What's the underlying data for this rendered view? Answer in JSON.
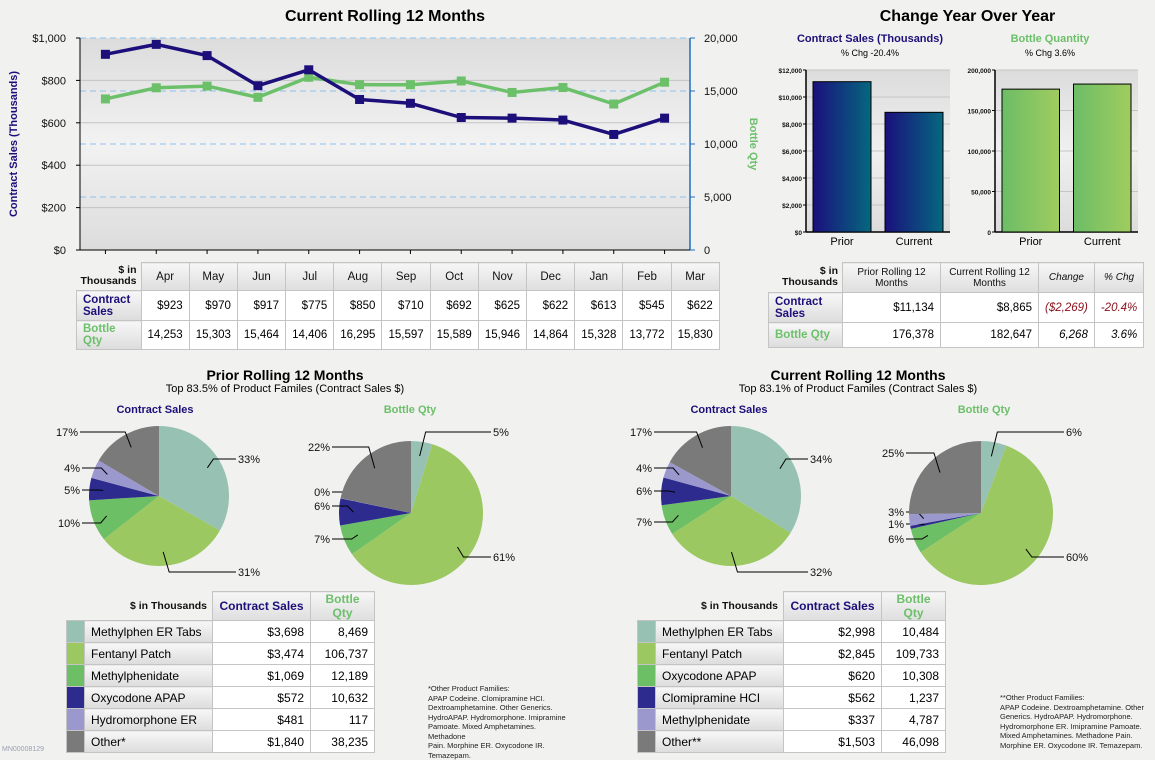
{
  "colors": {
    "navy": "#1c0f7a",
    "green": "#6cc06a",
    "teal": "#97c2b3",
    "lime": "#9cc862",
    "midgreen": "#6cbf64",
    "indigo": "#2e2b8f",
    "lavender": "#9a98cc",
    "gray": "#7a7a7a",
    "negative": "#8a0f1a"
  },
  "chart_data": [
    {
      "type": "line",
      "title": "Current Rolling 12 Months",
      "ylabel": "Contract Sales (Thousands)",
      "y2label": "Bottle Qty",
      "categories": [
        "Apr",
        "May",
        "Jun",
        "Jul",
        "Aug",
        "Sep",
        "Oct",
        "Nov",
        "Dec",
        "Jan",
        "Feb",
        "Mar"
      ],
      "series": [
        {
          "name": "Contract Sales",
          "axis": "left",
          "values": [
            923,
            970,
            917,
            775,
            850,
            710,
            692,
            625,
            622,
            613,
            545,
            622
          ]
        },
        {
          "name": "Bottle Qty",
          "axis": "right",
          "values": [
            14253,
            15303,
            15464,
            14406,
            16295,
            15597,
            15589,
            15946,
            14864,
            15328,
            13772,
            15830
          ]
        }
      ],
      "ylim": [
        0,
        1000
      ],
      "yticks": [
        "$0",
        "$200",
        "$400",
        "$600",
        "$800",
        "$1,000"
      ],
      "y2lim": [
        0,
        20000
      ],
      "y2ticks": [
        "0",
        "5,000",
        "10,000",
        "15,000",
        "20,000"
      ],
      "grid": true
    },
    {
      "type": "bar",
      "title": "Contract Sales (Thousands)",
      "subtitle": "% Chg -20.4%",
      "categories": [
        "Prior",
        "Current"
      ],
      "values": [
        11134,
        8865
      ],
      "ylim": [
        0,
        12000
      ],
      "yticks": [
        "$0",
        "$2,000",
        "$4,000",
        "$6,000",
        "$8,000",
        "$10,000",
        "$12,000"
      ]
    },
    {
      "type": "bar",
      "title": "Bottle Quantity",
      "subtitle": "% Chg 3.6%",
      "categories": [
        "Prior",
        "Current"
      ],
      "values": [
        176378,
        182647
      ],
      "ylim": [
        0,
        200000
      ],
      "yticks": [
        "0",
        "50,000",
        "100,000",
        "150,000",
        "200,000"
      ]
    },
    {
      "type": "pie",
      "title": "Contract Sales",
      "group": "Prior Rolling 12 Months",
      "labels": [
        "Methylphen ER Tabs",
        "Fentanyl Patch",
        "Methylphenidate",
        "Oxycodone APAP",
        "Hydromorphone ER",
        "Other*"
      ],
      "values": [
        3698,
        3474,
        1069,
        572,
        481,
        1840
      ],
      "pct_labels": [
        "33%",
        "31%",
        "10%",
        "5%",
        "4%",
        "17%"
      ]
    },
    {
      "type": "pie",
      "title": "Bottle Qty",
      "group": "Prior Rolling 12 Months",
      "labels": [
        "Methylphen ER Tabs",
        "Fentanyl Patch",
        "Methylphenidate",
        "Oxycodone APAP",
        "Hydromorphone ER",
        "Other*"
      ],
      "values": [
        8469,
        106737,
        12189,
        10632,
        117,
        38235
      ],
      "pct_labels": [
        "5%",
        "61%",
        "7%",
        "6%",
        "0%",
        "22%"
      ]
    },
    {
      "type": "pie",
      "title": "Contract Sales",
      "group": "Current Rolling 12 Months",
      "labels": [
        "Methylphen ER Tabs",
        "Fentanyl Patch",
        "Oxycodone APAP",
        "Clomipramine HCI",
        "Methylphenidate",
        "Other**"
      ],
      "values": [
        2998,
        2845,
        620,
        562,
        337,
        1503
      ],
      "pct_labels": [
        "34%",
        "32%",
        "7%",
        "6%",
        "4%",
        "17%"
      ]
    },
    {
      "type": "pie",
      "title": "Bottle Qty",
      "group": "Current Rolling 12 Months",
      "labels": [
        "Methylphen ER Tabs",
        "Fentanyl Patch",
        "Oxycodone APAP",
        "Clomipramine HCI",
        "Methylphenidate",
        "Other**"
      ],
      "values": [
        10484,
        109733,
        10308,
        1237,
        4787,
        46098
      ],
      "pct_labels": [
        "6%",
        "60%",
        "6%",
        "1%",
        "3%",
        "25%"
      ]
    }
  ],
  "line_section": {
    "title": "Current Rolling 12 Months",
    "ylabel": "Contract Sales (Thousands)",
    "y2label": "Bottle Qty"
  },
  "monthly_table": {
    "corner": [
      "$ in",
      "Thousands"
    ],
    "months": [
      "Apr",
      "May",
      "Jun",
      "Jul",
      "Aug",
      "Sep",
      "Oct",
      "Nov",
      "Dec",
      "Jan",
      "Feb",
      "Mar"
    ],
    "rows": [
      {
        "label": [
          "Contract",
          "Sales"
        ],
        "values": [
          "$923",
          "$970",
          "$917",
          "$775",
          "$850",
          "$710",
          "$692",
          "$625",
          "$622",
          "$613",
          "$545",
          "$622"
        ]
      },
      {
        "label": [
          "Bottle",
          "Qty"
        ],
        "values": [
          "14,253",
          "15,303",
          "15,464",
          "14,406",
          "16,295",
          "15,597",
          "15,589",
          "15,946",
          "14,864",
          "15,328",
          "13,772",
          "15,830"
        ]
      }
    ]
  },
  "yoy": {
    "title": "Change Year Over Year",
    "sales_title": "Contract Sales (Thousands)",
    "sales_sub": "% Chg -20.4%",
    "qty_title": "Bottle Quantity",
    "qty_sub": "% Chg 3.6%",
    "table": {
      "corner": [
        "$ in",
        "Thousands"
      ],
      "headers": [
        [
          "Prior Rolling 12",
          "Months"
        ],
        [
          "Current Rolling 12",
          "Months"
        ],
        [
          "Change"
        ],
        [
          "% Chg"
        ]
      ],
      "rows": [
        {
          "label": [
            "Contract",
            "Sales"
          ],
          "prior": "$11,134",
          "current": "$8,865",
          "change": "($2,269)",
          "pct": "-20.4%"
        },
        {
          "label": [
            "Bottle Qty"
          ],
          "prior": "176,378",
          "current": "182,647",
          "change": "6,268",
          "pct": "3.6%"
        }
      ]
    }
  },
  "prior": {
    "title": "Prior Rolling 12 Months",
    "subtitle": "Top 83.5% of Product Familes (Contract Sales $)",
    "pie1_title": "Contract Sales",
    "pie2_title": "Bottle Qty",
    "table": {
      "corner": "$ in Thousands",
      "col1": "Contract Sales",
      "col2": "Bottle Qty",
      "rows": [
        {
          "name": "Methylphen ER Tabs",
          "sales": "$3,698",
          "qty": "8,469"
        },
        {
          "name": "Fentanyl Patch",
          "sales": "$3,474",
          "qty": "106,737"
        },
        {
          "name": "Methylphenidate",
          "sales": "$1,069",
          "qty": "12,189"
        },
        {
          "name": "Oxycodone APAP",
          "sales": "$572",
          "qty": "10,632"
        },
        {
          "name": "Hydromorphone ER",
          "sales": "$481",
          "qty": "117"
        },
        {
          "name": "Other*",
          "sales": "$1,840",
          "qty": "38,235"
        }
      ]
    },
    "footnote": [
      "*Other Product Families:",
      "APAP Codeine. Clomipramine HCI.",
      "Dextroamphetamine. Other Generics.",
      "HydroAPAP. Hydromorphone. Imipramine",
      "Pamoate. Mixed Amphetamines. Methadone",
      "Pain. Morphine ER. Oxycodone IR.",
      "Temazepam."
    ]
  },
  "current": {
    "title": "Current Rolling 12 Months",
    "subtitle": "Top 83.1% of Product Familes (Contract Sales $)",
    "pie1_title": "Contract Sales",
    "pie2_title": "Bottle Qty",
    "table": {
      "corner": "$ in Thousands",
      "col1": "Contract Sales",
      "col2": "Bottle Qty",
      "rows": [
        {
          "name": "Methylphen ER Tabs",
          "sales": "$2,998",
          "qty": "10,484"
        },
        {
          "name": "Fentanyl Patch",
          "sales": "$2,845",
          "qty": "109,733"
        },
        {
          "name": "Oxycodone APAP",
          "sales": "$620",
          "qty": "10,308"
        },
        {
          "name": "Clomipramine HCI",
          "sales": "$562",
          "qty": "1,237"
        },
        {
          "name": "Methylphenidate",
          "sales": "$337",
          "qty": "4,787"
        },
        {
          "name": "Other**",
          "sales": "$1,503",
          "qty": "46,098"
        }
      ]
    },
    "footnote": [
      "**Other Product Families:",
      "APAP Codeine. Dextroamphetamine. Other",
      "Generics. HydroAPAP. Hydromorphone.",
      "Hydromorphone ER. Imipramine Pamoate.",
      "Mixed Amphetamines. Methadone Pain.",
      "Morphine ER. Oxycodone IR. Temazepam."
    ]
  },
  "watermark": "MN00008129"
}
